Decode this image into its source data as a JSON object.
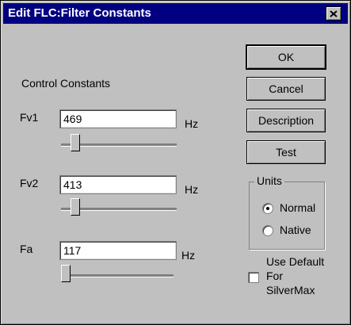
{
  "window": {
    "title": "Edit FLC:Filter Constants"
  },
  "main": {
    "section_label": "Control Constants",
    "fields": [
      {
        "label": "Fv1",
        "value": "469",
        "unit": "Hz",
        "slider_position": 0.1
      },
      {
        "label": "Fv2",
        "value": "413",
        "unit": "Hz",
        "slider_position": 0.1
      },
      {
        "label": "Fa",
        "value": "117",
        "unit": "Hz",
        "slider_position": 0.0
      }
    ]
  },
  "buttons": {
    "ok": "OK",
    "cancel": "Cancel",
    "description": "Description",
    "test": "Test"
  },
  "units": {
    "title": "Units",
    "options": [
      {
        "label": "Normal",
        "selected": true
      },
      {
        "label": "Native",
        "selected": false
      }
    ]
  },
  "default_option": {
    "label_line1": "Use Default",
    "label_line2": "For",
    "label_line3": "SilverMax",
    "checked": false
  },
  "icons": {
    "close": "close-icon"
  }
}
